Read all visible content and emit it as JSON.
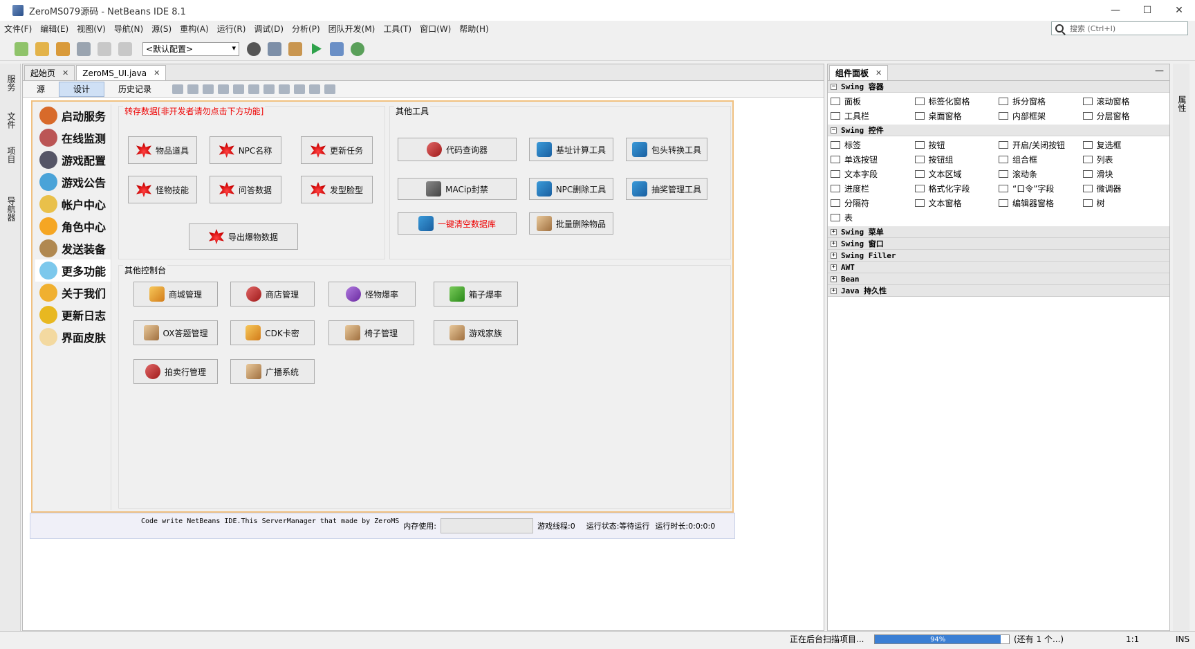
{
  "window": {
    "title": "ZeroMS079源码 - NetBeans IDE 8.1",
    "min": "—",
    "max": "☐",
    "close": "✕"
  },
  "menu": [
    "文件(F)",
    "编辑(E)",
    "视图(V)",
    "导航(N)",
    "源(S)",
    "重构(A)",
    "运行(R)",
    "调试(D)",
    "分析(P)",
    "团队开发(M)",
    "工具(T)",
    "窗口(W)",
    "帮助(H)"
  ],
  "search": {
    "placeholder": "搜索 (Ctrl+I)"
  },
  "toolbar": {
    "config_value": "<默认配置>"
  },
  "left_strip": {
    "items": [
      "服务",
      "文件",
      "项目",
      "导航器"
    ]
  },
  "editor": {
    "tabs": [
      {
        "label": "起始页",
        "close": "✕"
      },
      {
        "label": "ZeroMS_UI.java",
        "close": "✕"
      }
    ],
    "subtabs": [
      "源",
      "设计",
      "历史记录"
    ]
  },
  "form": {
    "sidebar": [
      "启动服务",
      "在线监测",
      "游戏配置",
      "游戏公告",
      "帐户中心",
      "角色中心",
      "发送装备",
      "更多功能",
      "关于我们",
      "更新日志",
      "界面皮肤"
    ],
    "dump_panel": {
      "title": "转存数据[非开发者请勿点击下方功能]",
      "buttons": [
        "物品道具",
        "NPC名称",
        "更新任务",
        "怪物技能",
        "问答数据",
        "发型脸型",
        "导出爆物数据"
      ]
    },
    "tools_panel": {
      "title": "其他工具",
      "buttons": [
        "代码查询器",
        "基址计算工具",
        "包头转换工具",
        "MACip封禁",
        "NPC删除工具",
        "抽奖管理工具",
        "一键清空数据库",
        "批量删除物品"
      ]
    },
    "console_panel": {
      "title": "其他控制台",
      "buttons": [
        "商城管理",
        "商店管理",
        "怪物爆率",
        "箱子爆率",
        "OX答题管理",
        "CDK卡密",
        "椅子管理",
        "游戏家族",
        "拍卖行管理",
        "广播系统"
      ]
    },
    "status": {
      "credit": "Code write NetBeans IDE.This ServerManager that made by ZeroMS",
      "memory_label": "内存使用:",
      "threads": "游戏线程:0",
      "run_state": "运行状态:等待运行",
      "run_time": "运行时长:0:0:0:0"
    }
  },
  "palette": {
    "tab": "组件面板",
    "categories": [
      {
        "name": "Swing 容器",
        "items": [
          "面板",
          "标签化窗格",
          "拆分窗格",
          "滚动窗格",
          "工具栏",
          "桌面窗格",
          "内部框架",
          "分层窗格"
        ]
      },
      {
        "name": "Swing 控件",
        "items": [
          "标签",
          "按钮",
          "开启/关闭按钮",
          "复选框",
          "单选按钮",
          "按钮组",
          "组合框",
          "列表",
          "文本字段",
          "文本区域",
          "滚动条",
          "滑块",
          "进度栏",
          "格式化字段",
          "“口令”字段",
          "微调器",
          "分隔符",
          "文本窗格",
          "编辑器窗格",
          "树",
          "表"
        ]
      },
      {
        "name": "Swing 菜单",
        "items": []
      },
      {
        "name": "Swing 窗口",
        "items": []
      },
      {
        "name": "Swing Filler",
        "items": []
      },
      {
        "name": "AWT",
        "items": []
      },
      {
        "name": "Bean",
        "items": []
      },
      {
        "name": "Java 持久性",
        "items": []
      }
    ]
  },
  "right_strip": {
    "label": "属性"
  },
  "statusbar": {
    "scan": "正在后台扫描项目...",
    "progress_label": "94%",
    "progress": 0.94,
    "more": "(还有 1 个...)",
    "pos": "1:1",
    "mode": "INS"
  }
}
